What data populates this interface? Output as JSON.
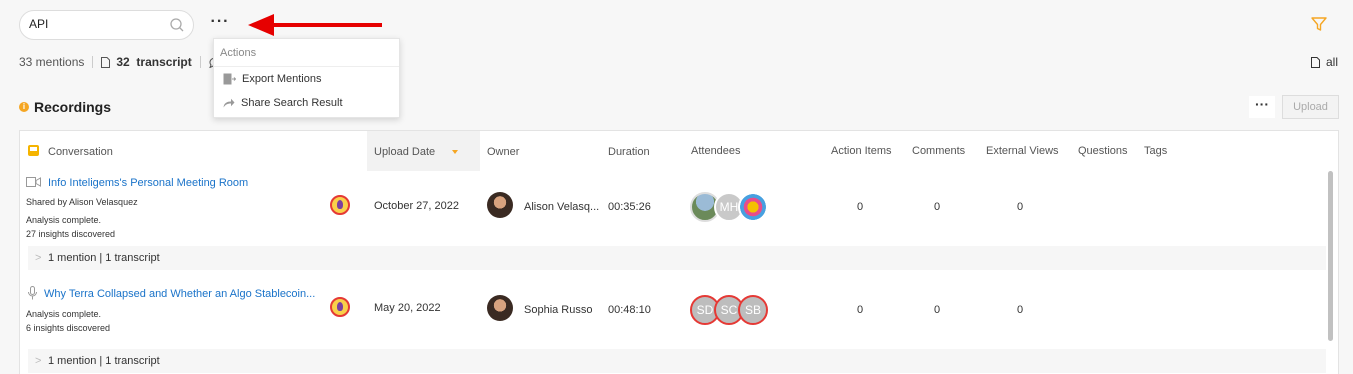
{
  "search": {
    "value": "API"
  },
  "mentions": {
    "count_text": "33 mentions",
    "transcript_count": "32",
    "transcript_label": "transcript"
  },
  "all_label": "all",
  "actions_menu": {
    "header": "Actions",
    "items": [
      {
        "label": "Export Mentions",
        "icon": "export-icon"
      },
      {
        "label": "Share Search Result",
        "icon": "share-icon"
      }
    ]
  },
  "recordings": {
    "title": "Recordings",
    "upload_label": "Upload"
  },
  "table": {
    "headers": [
      "Conversation",
      "Upload Date",
      "Owner",
      "Duration",
      "Attendees",
      "Action Items",
      "Comments",
      "External Views",
      "Questions",
      "Tags"
    ],
    "rows": [
      {
        "title": "Info Inteligems's Personal Meeting Room",
        "shared_by": "Shared by Alison Velasquez",
        "status": "Analysis complete.",
        "insights": "27 insights discovered",
        "date": "October 27, 2022",
        "owner": "Alison Velasq...",
        "duration": "00:35:26",
        "attendees": [
          "",
          "MH",
          ""
        ],
        "action_items": "0",
        "comments": "0",
        "external_views": "0",
        "mention_summary": "1 mention | 1 transcript"
      },
      {
        "title": "Why Terra Collapsed and Whether an Algo Stablecoin...",
        "status": "Analysis complete.",
        "insights": "6 insights discovered",
        "date": "May 20, 2022",
        "owner": "Sophia Russo",
        "duration": "00:48:10",
        "attendees": [
          "SD",
          "SC",
          "SB"
        ],
        "action_items": "0",
        "comments": "0",
        "external_views": "0",
        "mention_summary": "1 mention | 1 transcript"
      }
    ]
  },
  "colors": {
    "accent": "#f5a623",
    "link": "#1a73c9",
    "arrow": "#e60000"
  }
}
